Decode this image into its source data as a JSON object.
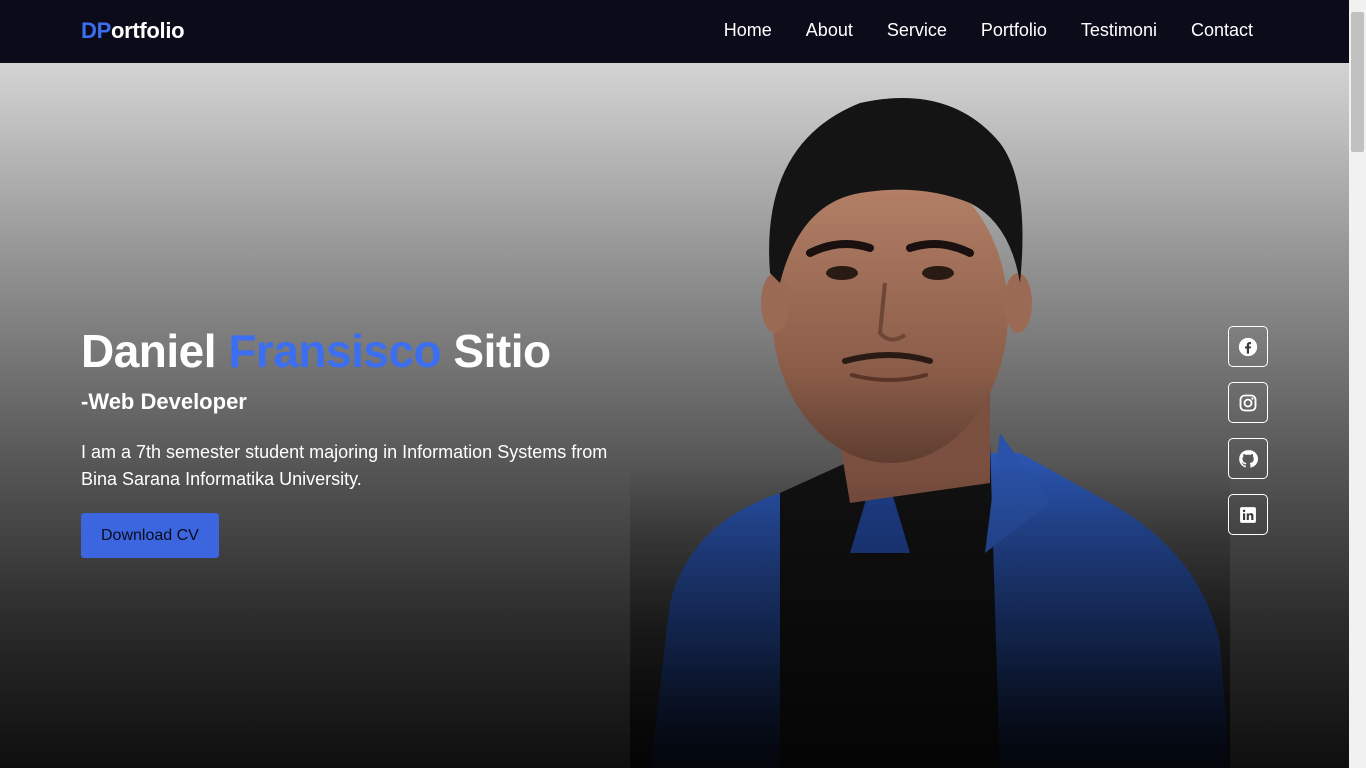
{
  "brand": {
    "prefix": "DP",
    "rest": "ortfolio"
  },
  "nav": {
    "items": [
      {
        "label": "Home"
      },
      {
        "label": "About"
      },
      {
        "label": "Service"
      },
      {
        "label": "Portfolio"
      },
      {
        "label": "Testimoni"
      },
      {
        "label": "Contact"
      }
    ]
  },
  "hero": {
    "name_first": "Daniel",
    "name_middle": "Fransisco",
    "name_last": "Sitio",
    "role": "-Web Developer",
    "description": "I am a 7th semester student majoring in Information Systems from Bina Sarana Informatika University.",
    "cta_label": "Download CV"
  },
  "socials": [
    {
      "icon": "facebook-icon"
    },
    {
      "icon": "instagram-icon"
    },
    {
      "icon": "github-icon"
    },
    {
      "icon": "linkedin-icon"
    }
  ],
  "colors": {
    "accent": "#3b6ef0",
    "navbar": "#0b0b1a",
    "button": "#3b66e0"
  }
}
